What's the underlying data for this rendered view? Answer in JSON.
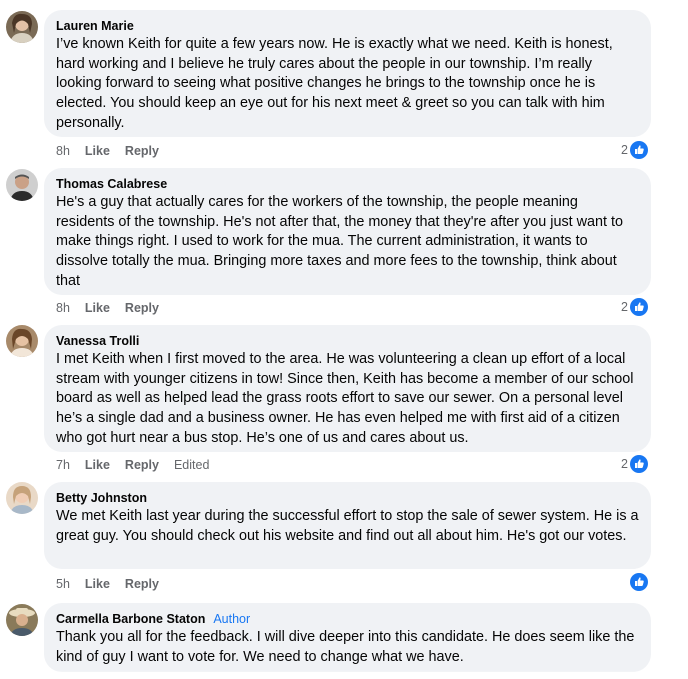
{
  "comments": [
    {
      "author": "Lauren Marie",
      "badge": "",
      "text": "I’ve known Keith for quite a few years now. He is exactly what we need. Keith is honest, hard working and I believe he truly cares about the people in our township. I’m really looking forward to seeing what positive changes he brings to the township once he is elected. You should keep an eye out for his next meet & greet so you can talk with him personally.",
      "time": "8h",
      "like": "Like",
      "reply": "Reply",
      "edited": "",
      "reaction_count": "2",
      "avatar_color": "#6b5a48"
    },
    {
      "author": "Thomas Calabrese",
      "badge": "",
      "text": "He's a guy that actually cares for the workers of the township, the people meaning residents of the township. He's not after that, the money that they're after you just want to make things right. I used to work for the mua. The current administration, it wants to dissolve totally the mua. Bringing more taxes and more fees to the township, think about that",
      "time": "8h",
      "like": "Like",
      "reply": "Reply",
      "edited": "",
      "reaction_count": "2",
      "avatar_color": "#3a3a3a"
    },
    {
      "author": "Vanessa Trolli",
      "badge": "",
      "text": "I met Keith when I first moved to the area. He was volunteering a clean up effort of a local stream with younger citizens in tow! Since then, Keith has become a member of our school board as well as helped lead the grass roots effort to save our sewer. On a personal level he’s a single dad and a business owner. He has even helped me with first aid of a citizen who got hurt near a bus stop. He’s one of us and cares about us.",
      "time": "7h",
      "like": "Like",
      "reply": "Reply",
      "edited": "Edited",
      "reaction_count": "2",
      "avatar_color": "#8a6a4a"
    },
    {
      "author": "Betty Johnston",
      "badge": "",
      "text": "We met Keith last year during the successful effort to stop the sale of sewer system. He is a great guy. You should check out his website and find out all about him. He's got our votes.",
      "time": "5h",
      "like": "Like",
      "reply": "Reply",
      "edited": "",
      "reaction_count": "",
      "avatar_color": "#c9a58a"
    },
    {
      "author": "Carmella Barbone Staton",
      "badge": "Author",
      "text": "Thank you all for the feedback. I will dive deeper into this candidate. He does seem like the kind of guy I want to vote for. We need to change what we have.",
      "time": "",
      "like": "",
      "reply": "",
      "edited": "",
      "reaction_count": "",
      "avatar_color": "#6d5b3a"
    }
  ],
  "colors": {
    "bubble": "#f0f2f5",
    "meta": "#65676b",
    "accent": "#1877f2"
  }
}
